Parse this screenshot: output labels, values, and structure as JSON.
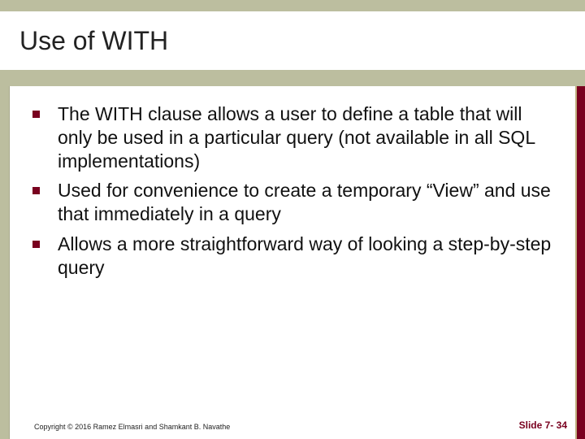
{
  "title": "Use of WITH",
  "bullets": [
    "The WITH clause allows a user to define a table that will only be used in a particular query (not available in all SQL implementations)",
    "Used for convenience to create a temporary “View” and use that immediately in a query",
    "Allows a more straightforward way of looking a step-by-step query"
  ],
  "footer": {
    "copyright": "Copyright © 2016 Ramez Elmasri and Shamkant B. Navathe",
    "slide_label": "Slide 7- 34"
  }
}
